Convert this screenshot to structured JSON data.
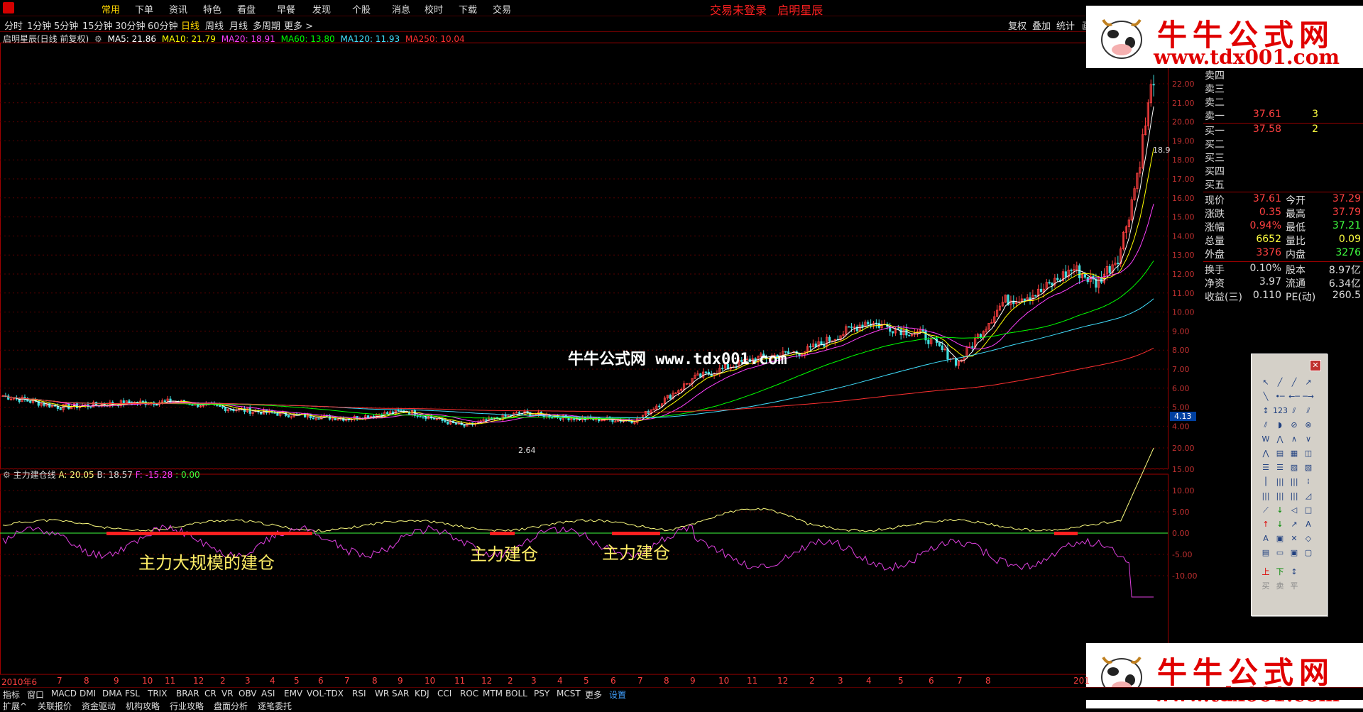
{
  "top_menu": [
    "常用",
    "下单",
    "资讯",
    "特色",
    "看盘",
    "早餐",
    "发现",
    "个股",
    "消息",
    "校时",
    "下载",
    "交易"
  ],
  "status_text": "交易未登录   启明星辰",
  "periods": [
    "分时",
    "1分钟",
    "5分钟",
    "15分钟",
    "30分钟",
    "60分钟",
    "日线",
    "周线",
    "月线",
    "多周期",
    "更多 >"
  ],
  "right_tools": [
    "复权",
    "叠加",
    "统计",
    "画"
  ],
  "main_legend": {
    "title": "启明星辰(日线 前复权)",
    "ma5": "MA5: 21.86",
    "ma10": "MA10: 21.79",
    "ma20": "MA20: 18.91",
    "ma60": "MA60: 13.80",
    "ma120": "MA120: 11.93",
    "ma250": "MA250: 10.04"
  },
  "price_axis": [
    "22.00",
    "21.00",
    "20.00",
    "19.00",
    "18.00",
    "17.00",
    "16.00",
    "15.00",
    "14.00",
    "13.00",
    "12.00",
    "11.00",
    "10.00",
    "9.00",
    "8.00",
    "7.00",
    "6.00",
    "5.00",
    "4.00"
  ],
  "current_price_tag": "4.13",
  "low_label": "2.64",
  "high_label": "18.9",
  "order_book": [
    {
      "label": "卖四",
      "price": "",
      "vol": ""
    },
    {
      "label": "卖三",
      "price": "",
      "vol": ""
    },
    {
      "label": "卖二",
      "price": "",
      "vol": ""
    },
    {
      "label": "卖一",
      "price": "37.61",
      "vol": "3"
    },
    {
      "label": "买一",
      "price": "37.58",
      "vol": "2"
    },
    {
      "label": "买二",
      "price": "",
      "vol": ""
    },
    {
      "label": "买三",
      "price": "",
      "vol": ""
    },
    {
      "label": "买四",
      "price": "",
      "vol": ""
    },
    {
      "label": "买五",
      "price": "",
      "vol": ""
    }
  ],
  "quote": [
    {
      "k1": "现价",
      "v1": "37.61",
      "k2": "今开",
      "v2": "37.29"
    },
    {
      "k1": "涨跌",
      "v1": "0.35",
      "k2": "最高",
      "v2": "37.79"
    },
    {
      "k1": "涨幅",
      "v1": "0.94%",
      "k2": "最低",
      "v2": "37.21"
    },
    {
      "k1": "总量",
      "v1": "6652",
      "k2": "量比",
      "v2": "0.09"
    },
    {
      "k1": "外盘",
      "v1": "3376",
      "k2": "内盘",
      "v2": "3276"
    }
  ],
  "fundamentals": [
    {
      "k1": "换手",
      "v1": "0.10%",
      "k2": "股本",
      "v2": "8.97亿"
    },
    {
      "k1": "净资",
      "v1": "3.97",
      "k2": "流通",
      "v2": "6.34亿"
    },
    {
      "k1": "收益(三)",
      "v1": "0.110",
      "k2": "PE(动)",
      "v2": "260.5"
    }
  ],
  "watermark": {
    "name": "牛牛公式网",
    "url": "www.tdx001.com",
    "mid": "牛牛公式网 www.tdx001.com"
  },
  "indicator_legend": {
    "name": "主力建仓线",
    "a": "A: 20.05",
    "b": "B: 18.57",
    "f": "F: -15.28",
    "z": ": 0.00"
  },
  "indicator_axis": [
    "20.00",
    "15.00",
    "10.00",
    "5.00",
    "0.00",
    "-5.00",
    "-10.00"
  ],
  "annotations": [
    "主力大规模的建仓",
    "主力建仓",
    "主力建仓"
  ],
  "time_axis": [
    "2010年6",
    "7",
    "8",
    "9",
    "10",
    "11",
    "12",
    "2",
    "3",
    "4",
    "5",
    "6",
    "7",
    "8",
    "9",
    "10",
    "11",
    "12",
    "2",
    "3",
    "4",
    "5",
    "6",
    "7",
    "8",
    "9",
    "10",
    "11",
    "12",
    "2",
    "3",
    "4",
    "5",
    "6",
    "7",
    "8",
    "201"
  ],
  "indicator_tabs": [
    "指标",
    "窗口",
    "MACD",
    "DMI",
    "DMA",
    "FSL",
    "TRIX",
    "BRAR",
    "CR",
    "VR",
    "OBV",
    "ASI",
    "EMV",
    "VOL-TDX",
    "RSI",
    "WR",
    "SAR",
    "KDJ",
    "CCI",
    "ROC",
    "MTM",
    "BOLL",
    "PSY",
    "MCST",
    "更多",
    "设置"
  ],
  "ext_tabs": [
    "扩展^",
    "关联报价",
    "资金驱动",
    "机构攻略",
    "行业攻略",
    "盘面分析",
    "逐笔委托"
  ],
  "drawtool_bottom": [
    "买",
    "卖",
    "平"
  ],
  "colors": {
    "ma5": "#ffffff",
    "ma10": "#ffff00",
    "ma20": "#ff40ff",
    "ma60": "#00ff00",
    "ma120": "#40e0ff",
    "ma250": "#ff3030"
  }
}
